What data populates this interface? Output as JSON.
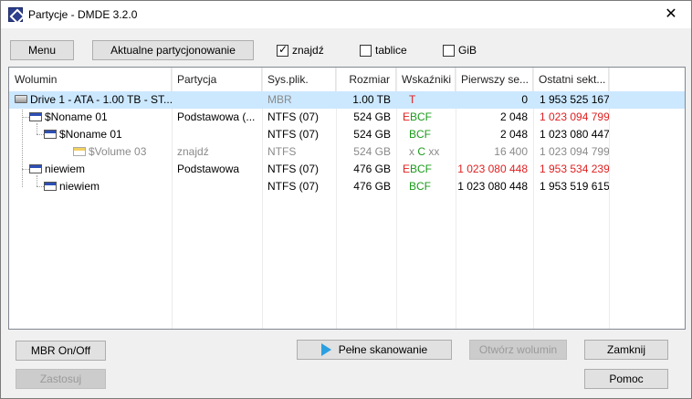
{
  "window": {
    "title": "Partycje - DMDE 3.2.0",
    "close_glyph": "✕"
  },
  "toolbar": {
    "menu_label": "Menu",
    "current_partitioning_label": "Aktualne partycjonowanie",
    "find_label": "znajdź",
    "find_checked": true,
    "tables_label": "tablice",
    "tables_checked": false,
    "gib_label": "GiB",
    "gib_checked": false
  },
  "table": {
    "columns": [
      "Wolumin",
      "Partycja",
      "Sys.plik.",
      "Rozmiar",
      "Wskaźniki",
      "Pierwszy se...",
      "Ostatni sekt..."
    ],
    "rows": [
      {
        "volume": "Drive 1 - ATA - 1.00 TB - ST...",
        "partition": "",
        "fs": "MBR",
        "size": "1.00 TB",
        "flags": "T",
        "first": "0",
        "last": "1 953 525 167"
      },
      {
        "volume": "$Noname 01",
        "partition": "Podstawowa (...",
        "fs": "NTFS (07)",
        "size": "524 GB",
        "flags_e": "E",
        "flags": "BCF",
        "first": "2 048",
        "last": "1 023 094 799"
      },
      {
        "volume": "$Noname 01",
        "partition": "",
        "fs": "NTFS (07)",
        "size": "524 GB",
        "flags": "BCF",
        "first": "2 048",
        "last": "1 023 080 447"
      },
      {
        "volume": "$Volume 03",
        "partition": "znajdź",
        "fs": "NTFS",
        "size": "524 GB",
        "flags_x1": "x",
        "flags": "C",
        "flags_x2": "xx",
        "first": "16 400",
        "last": "1 023 094 799"
      },
      {
        "volume": "niewiem",
        "partition": "Podstawowa",
        "fs": "NTFS (07)",
        "size": "476 GB",
        "flags_e": "E",
        "flags": "BCF",
        "first": "1 023 080 448",
        "last": "1 953 534 239"
      },
      {
        "volume": "niewiem",
        "partition": "",
        "fs": "NTFS (07)",
        "size": "476 GB",
        "flags": "BCF",
        "first": "1 023 080 448",
        "last": "1 953 519 615"
      }
    ]
  },
  "buttons": {
    "mbr_toggle": "MBR On/Off",
    "apply": "Zastosuj",
    "full_scan": "Pełne skanowanie",
    "open_volume": "Otwórz wolumin",
    "close": "Zamknij",
    "help": "Pomoc"
  },
  "colors": {
    "selection": "#cce8ff",
    "red": "#e02020",
    "green": "#1a9a1a",
    "gray": "#8a8a8a"
  }
}
